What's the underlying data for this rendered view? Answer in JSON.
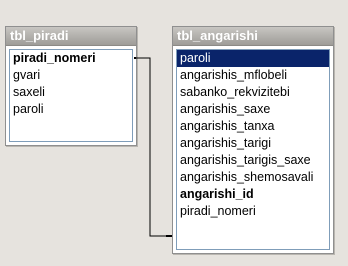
{
  "tables": [
    {
      "title": "tbl_piradi",
      "fields": [
        {
          "name": "piradi_nomeri",
          "key": true
        },
        {
          "name": "gvari",
          "key": false
        },
        {
          "name": "saxeli",
          "key": false
        },
        {
          "name": "paroli",
          "key": false
        }
      ]
    },
    {
      "title": "tbl_angarishi",
      "fields": [
        {
          "name": "paroli",
          "key": false,
          "selected": true
        },
        {
          "name": "angarishis_mflobeli",
          "key": false
        },
        {
          "name": "sabanko_rekvizitebi",
          "key": false
        },
        {
          "name": "angarishis_saxe",
          "key": false
        },
        {
          "name": "angarishis_tanxa",
          "key": false
        },
        {
          "name": "angarishis_tarigi",
          "key": false
        },
        {
          "name": "angarishis_tarigis_saxe",
          "key": false
        },
        {
          "name": "angarishis_shemosavali",
          "key": false
        },
        {
          "name": "angarishi_id",
          "key": true
        },
        {
          "name": "piradi_nomeri",
          "key": false
        }
      ]
    }
  ]
}
